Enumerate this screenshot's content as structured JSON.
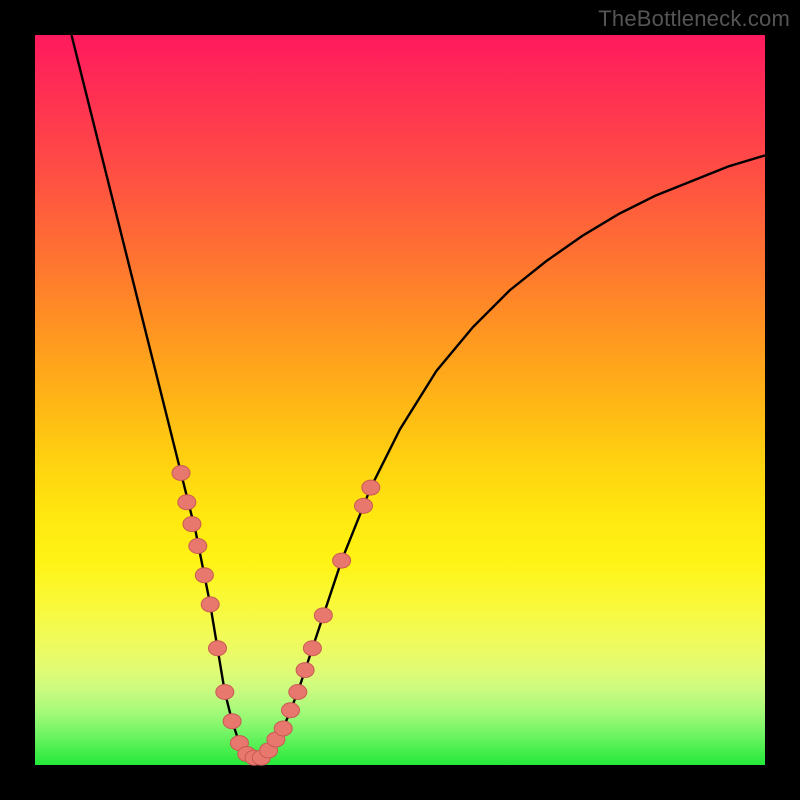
{
  "watermark": "TheBottleneck.com",
  "colors": {
    "frame": "#000000",
    "curve": "#000000",
    "marker_fill": "#e8776e",
    "marker_stroke": "#c85a52",
    "gradient_stops": [
      "#ff1a5e",
      "#ff6b35",
      "#ffd010",
      "#f0fb5c",
      "#24e838"
    ]
  },
  "chart_data": {
    "type": "line",
    "title": "",
    "xlabel": "",
    "ylabel": "",
    "xlim": [
      0,
      100
    ],
    "ylim": [
      0,
      100
    ],
    "grid": false,
    "series": [
      {
        "name": "bottleneck-curve",
        "x": [
          5,
          8,
          11,
          14,
          16,
          18,
          20,
          22,
          24,
          25,
          26,
          27,
          28,
          29,
          30,
          31,
          32,
          34,
          36,
          38,
          42,
          46,
          50,
          55,
          60,
          65,
          70,
          75,
          80,
          85,
          90,
          95,
          100
        ],
        "y": [
          100,
          88,
          76,
          64,
          56,
          48,
          40,
          32,
          22,
          16,
          10,
          6,
          3,
          1.5,
          1,
          1,
          2,
          5,
          10,
          16,
          28,
          38,
          46,
          54,
          60,
          65,
          69,
          72.5,
          75.5,
          78,
          80,
          82,
          83.5
        ]
      }
    ],
    "markers": [
      {
        "name": "left-branch-markers",
        "points": [
          {
            "x": 20.0,
            "y": 40
          },
          {
            "x": 20.8,
            "y": 36
          },
          {
            "x": 21.5,
            "y": 33
          },
          {
            "x": 22.3,
            "y": 30
          },
          {
            "x": 23.2,
            "y": 26
          },
          {
            "x": 24.0,
            "y": 22
          },
          {
            "x": 25.0,
            "y": 16
          },
          {
            "x": 26.0,
            "y": 10
          },
          {
            "x": 27.0,
            "y": 6
          },
          {
            "x": 28.0,
            "y": 3
          },
          {
            "x": 29.0,
            "y": 1.5
          },
          {
            "x": 30.0,
            "y": 1
          },
          {
            "x": 31.0,
            "y": 1
          }
        ]
      },
      {
        "name": "right-branch-markers",
        "points": [
          {
            "x": 32.0,
            "y": 2
          },
          {
            "x": 33.0,
            "y": 3.5
          },
          {
            "x": 34.0,
            "y": 5
          },
          {
            "x": 35.0,
            "y": 7.5
          },
          {
            "x": 36.0,
            "y": 10
          },
          {
            "x": 37.0,
            "y": 13
          },
          {
            "x": 38.0,
            "y": 16
          },
          {
            "x": 39.5,
            "y": 20.5
          },
          {
            "x": 42.0,
            "y": 28
          },
          {
            "x": 45.0,
            "y": 35.5
          },
          {
            "x": 46.0,
            "y": 38
          }
        ]
      }
    ]
  }
}
